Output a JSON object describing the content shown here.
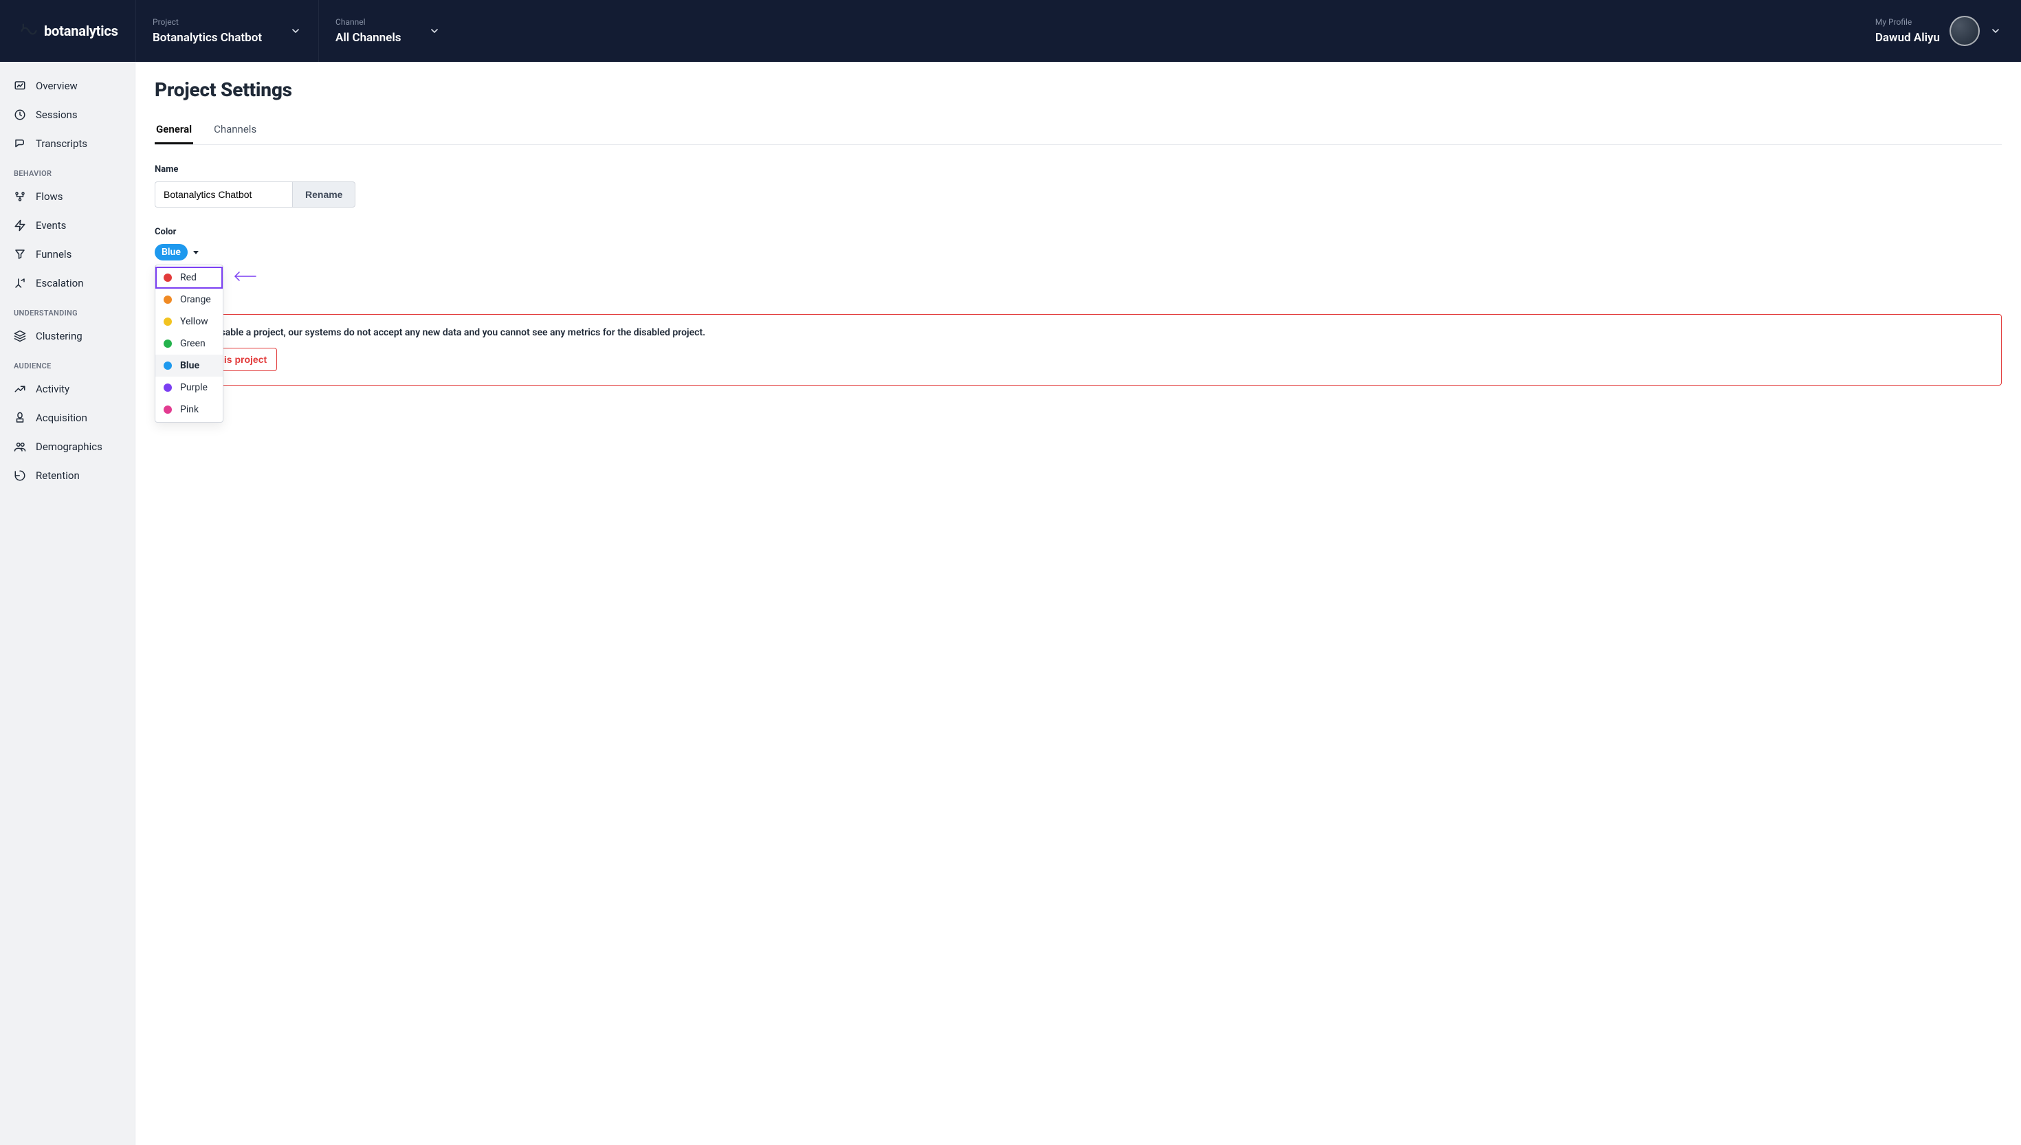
{
  "header": {
    "brand": "botanalytics",
    "project_label": "Project",
    "project_value": "Botanalytics Chatbot",
    "channel_label": "Channel",
    "channel_value": "All Channels",
    "profile_label": "My Profile",
    "profile_value": "Dawud Aliyu"
  },
  "sidebar": {
    "items_top": [
      {
        "icon": "chart-icon",
        "label": "Overview"
      },
      {
        "icon": "clock-icon",
        "label": "Sessions"
      },
      {
        "icon": "transcript-icon",
        "label": "Transcripts"
      }
    ],
    "section_behavior": "BEHAVIOR",
    "items_behavior": [
      {
        "icon": "flows-icon",
        "label": "Flows"
      },
      {
        "icon": "bolt-icon",
        "label": "Events"
      },
      {
        "icon": "funnel-icon",
        "label": "Funnels"
      },
      {
        "icon": "escalation-icon",
        "label": "Escalation"
      }
    ],
    "section_understanding": "UNDERSTANDING",
    "items_understanding": [
      {
        "icon": "layers-icon",
        "label": "Clustering"
      }
    ],
    "section_audience": "AUDIENCE",
    "items_audience": [
      {
        "icon": "activity-icon",
        "label": "Activity"
      },
      {
        "icon": "acquisition-icon",
        "label": "Acquisition"
      },
      {
        "icon": "demographics-icon",
        "label": "Demographics"
      },
      {
        "icon": "retention-icon",
        "label": "Retention"
      }
    ]
  },
  "main": {
    "title": "Project Settings",
    "tabs": {
      "general": "General",
      "channels": "Channels"
    },
    "name_label": "Name",
    "name_value": "Botanalytics Chatbot",
    "rename_label": "Rename",
    "color_label": "Color",
    "color_selected": "Blue",
    "color_options": [
      {
        "name": "Red",
        "hex": "#e23b3b"
      },
      {
        "name": "Orange",
        "hex": "#f08a24"
      },
      {
        "name": "Yellow",
        "hex": "#f2c320"
      },
      {
        "name": "Green",
        "hex": "#24b24c"
      },
      {
        "name": "Blue",
        "hex": "#1e99ee"
      },
      {
        "name": "Purple",
        "hex": "#7b3ff2"
      },
      {
        "name": "Pink",
        "hex": "#e23b90"
      }
    ],
    "danger_text": "When you disable a project, our systems do not accept any new data and you cannot see any metrics for the disabled project.",
    "disable_label": "Disable this project"
  }
}
